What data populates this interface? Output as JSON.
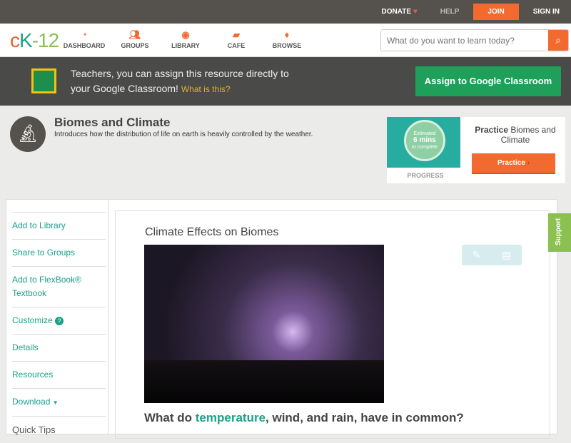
{
  "topbar": {
    "donate": "DONATE",
    "help": "HELP",
    "join": "JOIN",
    "signin": "SIGN IN"
  },
  "nav": {
    "logo": {
      "c": "c",
      "k": "K",
      "n": "-12"
    },
    "items": [
      {
        "label": "DASHBOARD",
        "icon": "dashboard-icon"
      },
      {
        "label": "GROUPS",
        "icon": "groups-icon"
      },
      {
        "label": "LIBRARY",
        "icon": "library-icon"
      },
      {
        "label": "CAFE",
        "icon": "cafe-icon"
      },
      {
        "label": "BROWSE",
        "icon": "browse-icon"
      }
    ],
    "search_placeholder": "What do you want to learn today?"
  },
  "banner": {
    "line1": "Teachers, you can assign this resource directly to",
    "line2": "your Google Classroom!",
    "link": "What is this?",
    "button": "Assign to Google Classroom"
  },
  "page": {
    "title": "Biomes and Climate",
    "description": "Introduces how the distribution of life on earth is heavily controlled by the weather."
  },
  "practice": {
    "est1": "Estimated",
    "est2": "6 mins",
    "est3": "to complete",
    "progress": "PROGRESS",
    "title_bold": "Practice",
    "title_rest": " Biomes and Climate",
    "button": "Practice"
  },
  "sidebar": {
    "add_library": "Add to Library",
    "share": "Share to Groups",
    "flexbook": "Add to FlexBook® Textbook",
    "customize": "Customize",
    "details": "Details",
    "resources": "Resources",
    "download": "Download",
    "tips": "Quick Tips"
  },
  "content": {
    "title": "Climate Effects on Biomes",
    "q1": "What do ",
    "q_hl": "temperature",
    "q2": ", wind, and rain, have in common?"
  },
  "support": "Support",
  "colors": {
    "accent": "#f26a30",
    "teal": "#1aa18a",
    "green": "#1ea05a"
  }
}
